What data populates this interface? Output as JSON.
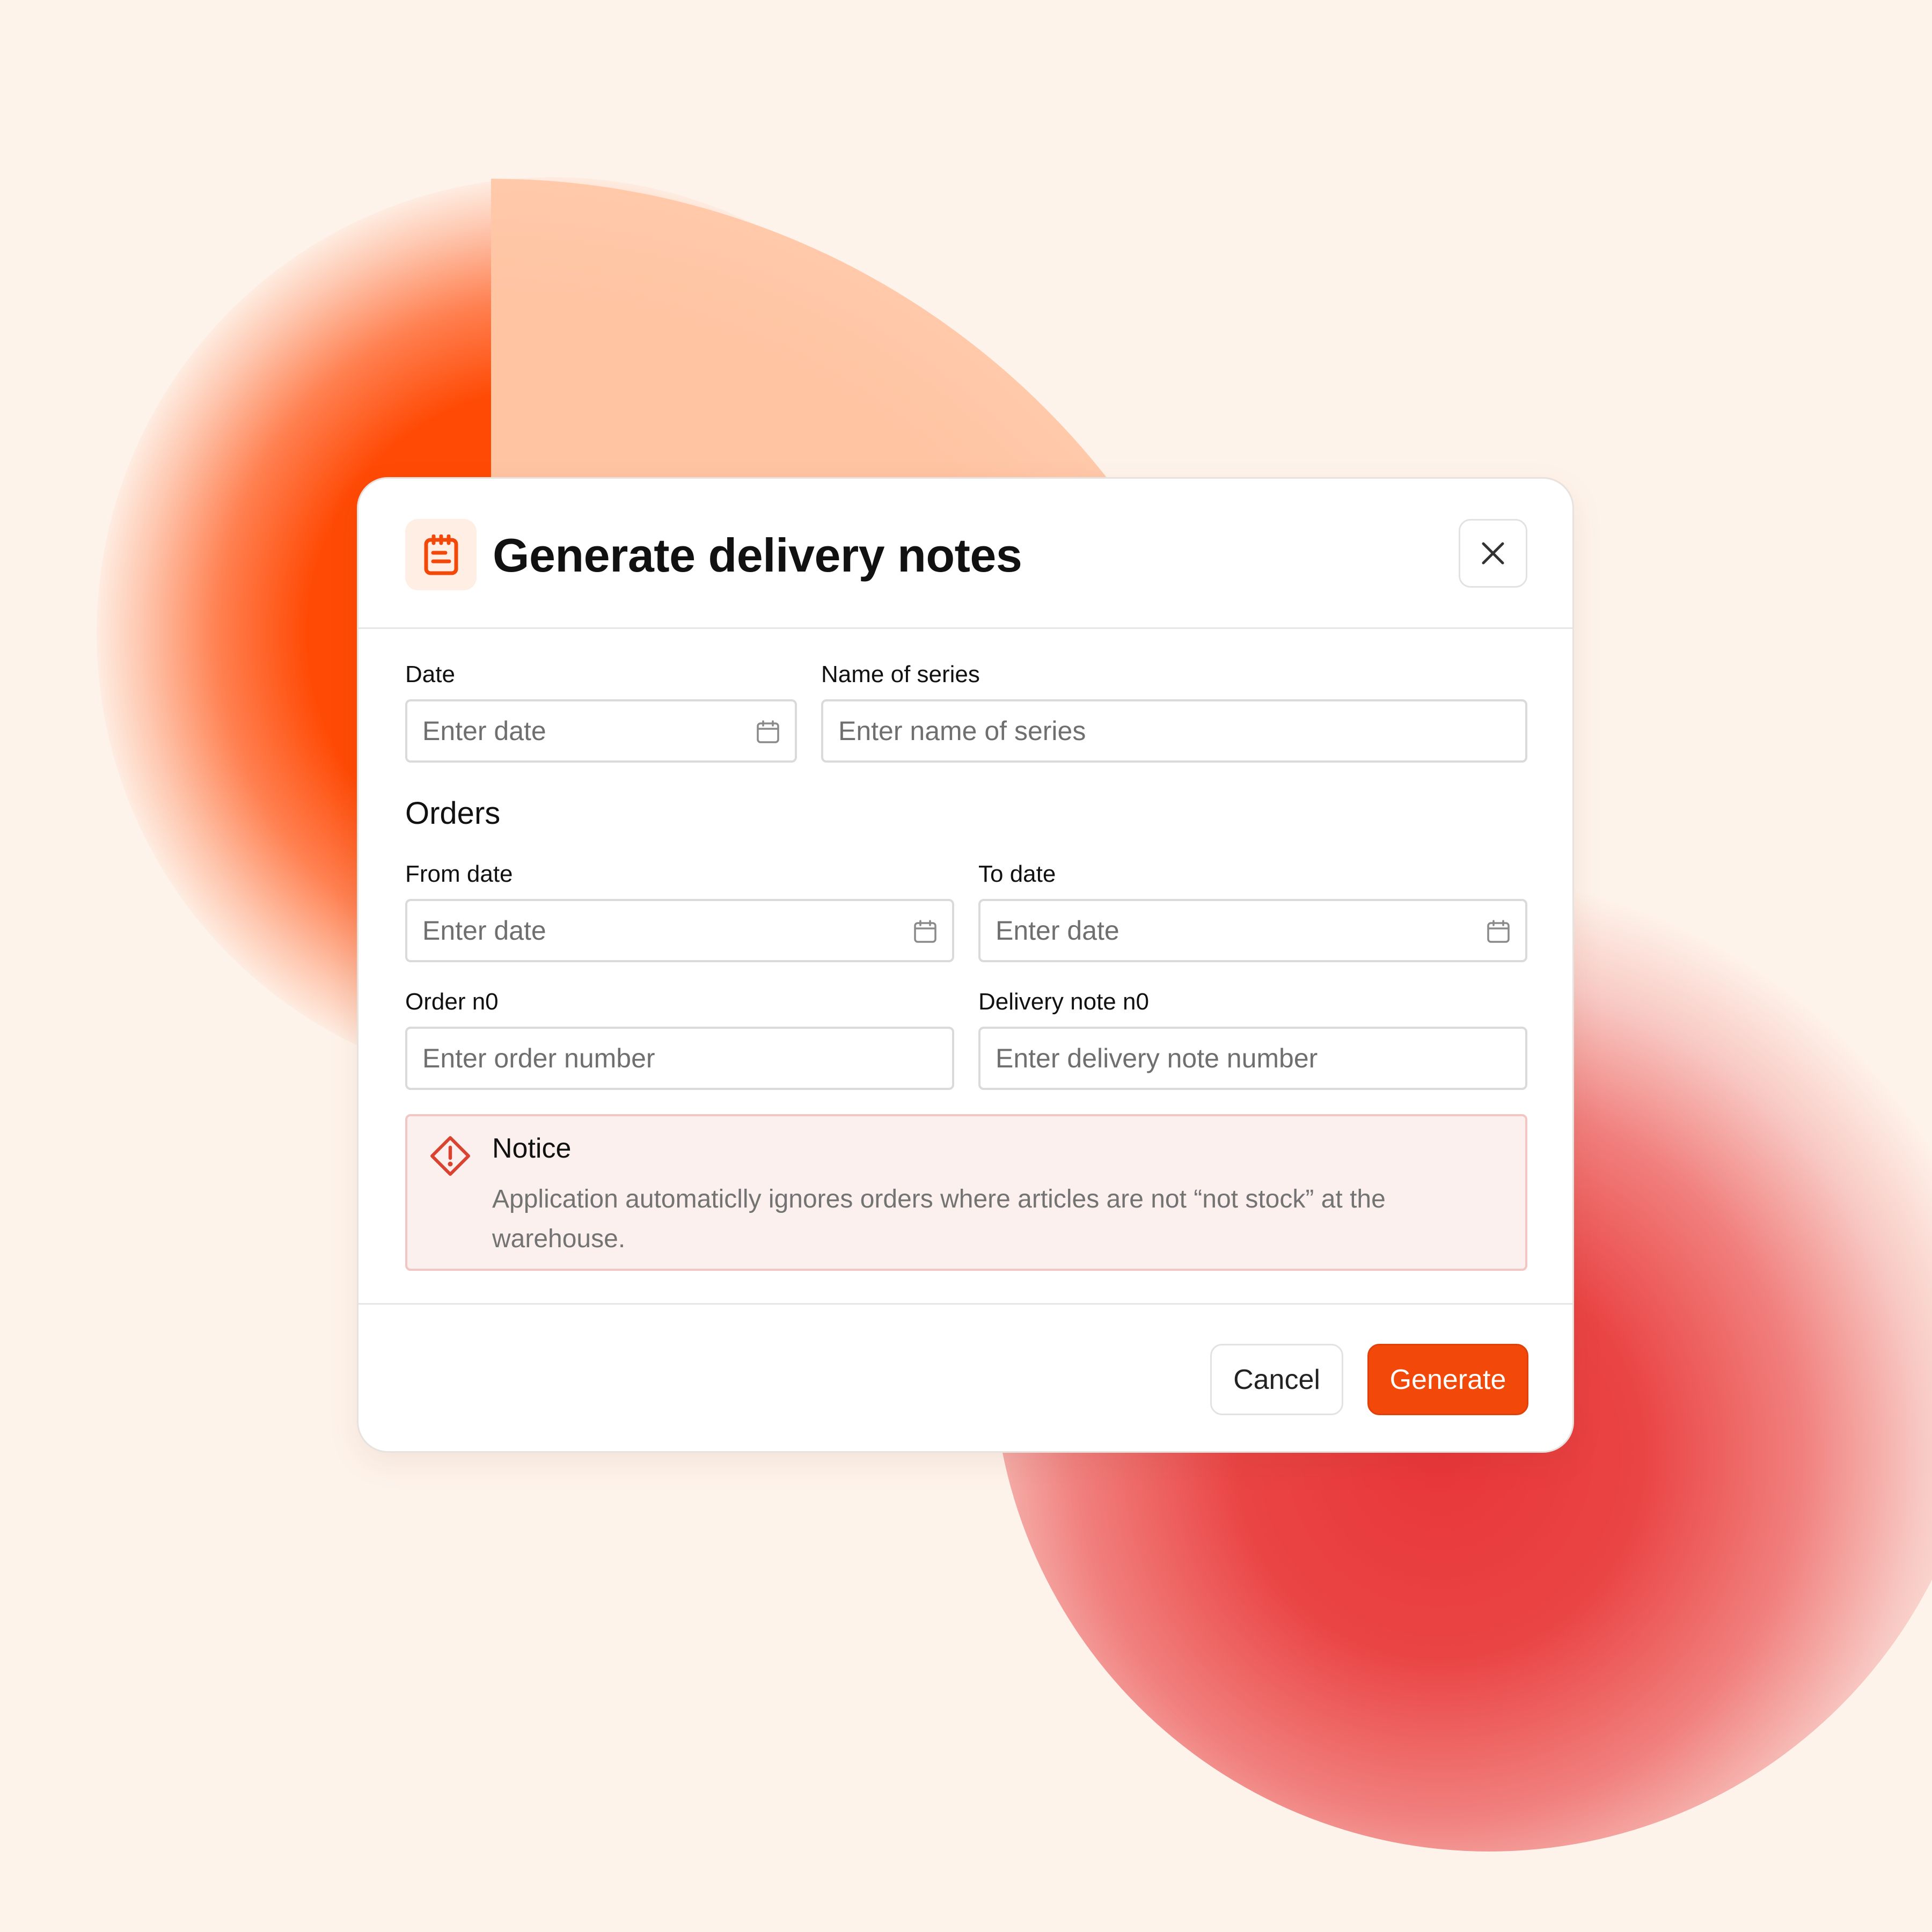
{
  "colors": {
    "background": "#FEF3EA",
    "accent": "#F2490A",
    "accent_soft": "#FFEEE4",
    "notice_bg": "#FCF0EE",
    "notice_border": "#F1C6C3",
    "notice_icon": "#D9432F",
    "blob_orange": "#FF4A05",
    "blob_peach": "#FFC4A2",
    "blob_red": "#E8363A"
  },
  "modal": {
    "icon": "clipboard-icon",
    "title": "Generate delivery notes",
    "close_icon": "close-icon"
  },
  "form": {
    "date": {
      "label": "Date",
      "placeholder": "Enter date",
      "icon": "calendar-icon"
    },
    "series": {
      "label": "Name of series",
      "placeholder": "Enter name of series"
    },
    "orders": {
      "title": "Orders",
      "from_date": {
        "label": "From date",
        "placeholder": "Enter date",
        "icon": "calendar-icon"
      },
      "to_date": {
        "label": "To date",
        "placeholder": "Enter date",
        "icon": "calendar-icon"
      },
      "order_no": {
        "label": "Order n0",
        "placeholder": "Enter order number"
      },
      "delivery_note_no": {
        "label": "Delivery note n0",
        "placeholder": "Enter delivery note number"
      }
    }
  },
  "notice": {
    "icon": "warning-diamond-icon",
    "title": "Notice",
    "text": "Application automaticlly ignores orders where articles are not “not stock” at the warehouse."
  },
  "footer": {
    "cancel_label": "Cancel",
    "generate_label": "Generate"
  }
}
